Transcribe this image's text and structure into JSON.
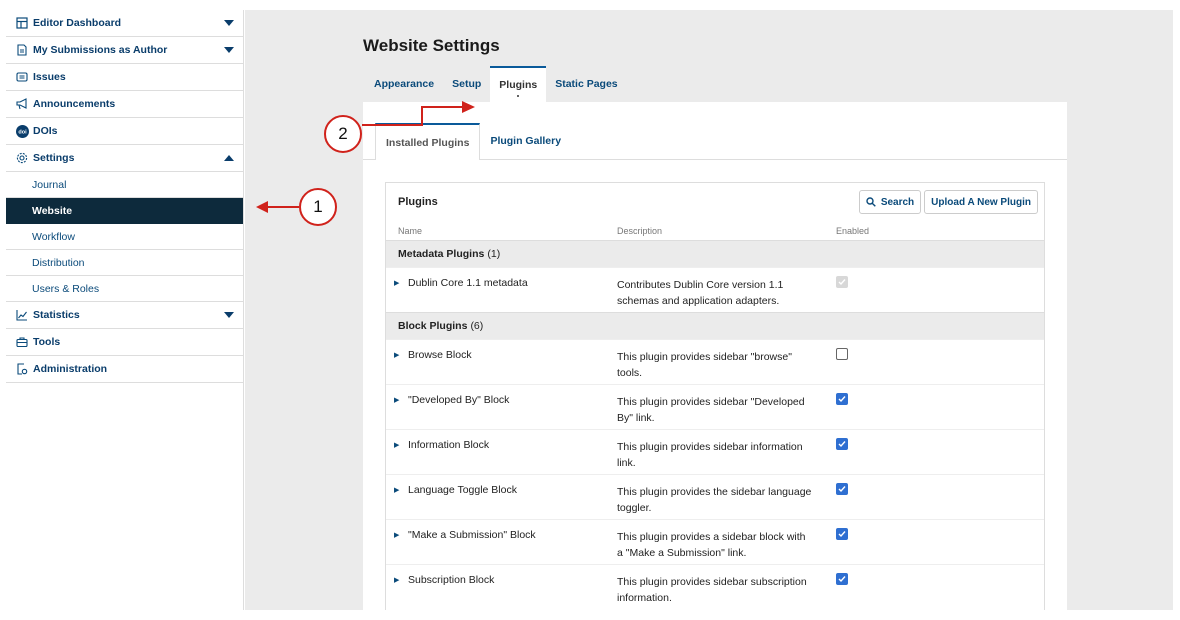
{
  "sidebar": {
    "items": [
      {
        "label": "Editor Dashboard",
        "icon": "dashboard-icon",
        "caret": "down"
      },
      {
        "label": "My Submissions as Author",
        "icon": "document-icon",
        "caret": "down"
      },
      {
        "label": "Issues",
        "icon": "issues-icon"
      },
      {
        "label": "Announcements",
        "icon": "megaphone-icon"
      },
      {
        "label": "DOIs",
        "icon": "doi-icon",
        "icon_text": "doi"
      },
      {
        "label": "Settings",
        "icon": "gear-icon",
        "caret": "up"
      },
      {
        "label": "Statistics",
        "icon": "chart-icon",
        "caret": "down"
      },
      {
        "label": "Tools",
        "icon": "toolbox-icon"
      },
      {
        "label": "Administration",
        "icon": "admin-icon"
      }
    ],
    "settings_sub": [
      "Journal",
      "Website",
      "Workflow",
      "Distribution",
      "Users & Roles"
    ],
    "active_sub": "Website"
  },
  "main": {
    "title": "Website Settings",
    "tabs": [
      "Appearance",
      "Setup",
      "Plugins",
      "Static Pages"
    ],
    "active_tab": "Plugins",
    "subtabs": [
      "Installed Plugins",
      "Plugin Gallery"
    ],
    "active_subtab": "Installed Plugins"
  },
  "grid": {
    "title": "Plugins",
    "search_label": "Search",
    "upload_label": "Upload A New Plugin",
    "columns": [
      "Name",
      "Description",
      "Enabled"
    ],
    "categories": [
      {
        "name": "Metadata Plugins",
        "count": "(1)",
        "rows": [
          {
            "name": "Dublin Core 1.1 metadata",
            "desc1": "Contributes Dublin Core version 1.1",
            "desc2": "schemas and application adapters.",
            "state": "disabled"
          }
        ]
      },
      {
        "name": "Block Plugins",
        "count": "(6)",
        "rows": [
          {
            "name": "Browse Block",
            "desc1": "This plugin provides sidebar \"browse\"",
            "desc2": "tools.",
            "state": "unchecked"
          },
          {
            "name": "\"Developed By\" Block",
            "desc1": "This plugin provides sidebar \"Developed",
            "desc2": "By\" link.",
            "state": "checked"
          },
          {
            "name": "Information Block",
            "desc1": "This plugin provides sidebar information",
            "desc2": "link.",
            "state": "checked"
          },
          {
            "name": "Language Toggle Block",
            "desc1": "This plugin provides the sidebar language",
            "desc2": "toggler.",
            "state": "checked"
          },
          {
            "name": "\"Make a Submission\" Block",
            "desc1": "This plugin provides a sidebar block with",
            "desc2": "a \"Make a Submission\" link.",
            "state": "checked"
          },
          {
            "name": "Subscription Block",
            "desc1": "This plugin provides sidebar subscription",
            "desc2": "information.",
            "state": "checked"
          }
        ]
      }
    ]
  },
  "annotations": {
    "marker1": "1",
    "marker2": "2",
    "color": "#d0221b"
  }
}
